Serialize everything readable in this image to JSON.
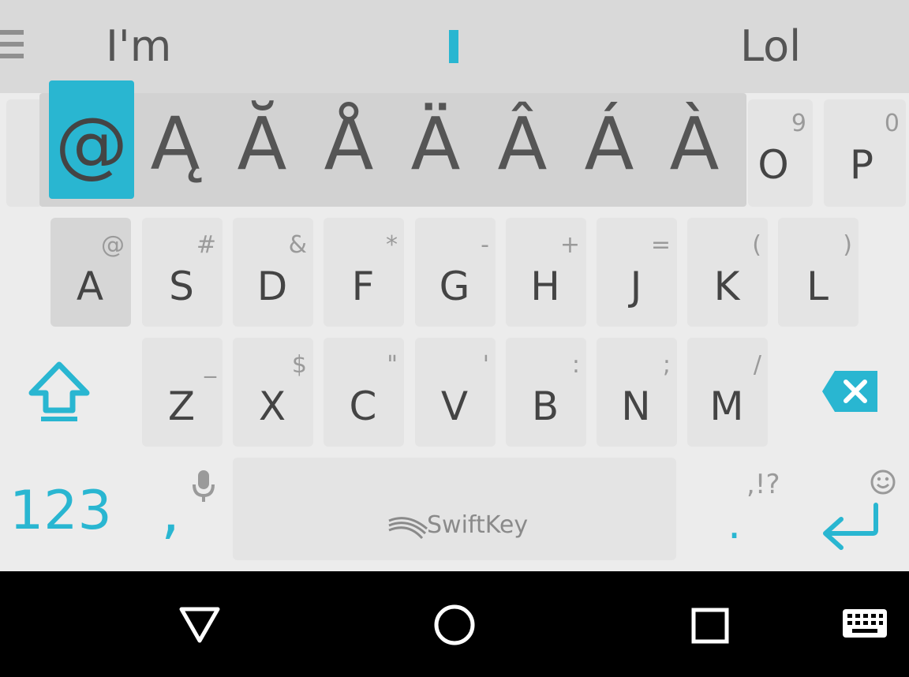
{
  "suggestions": {
    "left": "I'm",
    "middle": "",
    "right": "Lol"
  },
  "popup": {
    "selected": "@",
    "alternates": [
      "Ą",
      "Ă",
      "Å",
      "Ä",
      "Â",
      "Á",
      "À"
    ]
  },
  "row1": [
    {
      "main": "O",
      "hint": "9"
    },
    {
      "main": "P",
      "hint": "0"
    }
  ],
  "row2": [
    {
      "main": "A",
      "hint": "@"
    },
    {
      "main": "S",
      "hint": "#"
    },
    {
      "main": "D",
      "hint": "&"
    },
    {
      "main": "F",
      "hint": "*"
    },
    {
      "main": "G",
      "hint": "-"
    },
    {
      "main": "H",
      "hint": "+"
    },
    {
      "main": "J",
      "hint": "="
    },
    {
      "main": "K",
      "hint": "("
    },
    {
      "main": "L",
      "hint": ")"
    }
  ],
  "row3": [
    {
      "main": "Z",
      "hint": "_"
    },
    {
      "main": "X",
      "hint": "$"
    },
    {
      "main": "C",
      "hint": "\""
    },
    {
      "main": "V",
      "hint": "'"
    },
    {
      "main": "B",
      "hint": ":"
    },
    {
      "main": "N",
      "hint": ";"
    },
    {
      "main": "M",
      "hint": "/"
    }
  ],
  "bottom": {
    "numbers_label": "123",
    "comma_label": ",",
    "space_brand": "SwiftKey",
    "period_label": ".",
    "punct_hint": ",!?"
  },
  "colors": {
    "accent": "#29b6d1",
    "key_bg": "#e4e4e4",
    "keyboard_bg": "#ececec",
    "suggestion_bg": "#d9d9d9",
    "navbar_bg": "#000000"
  },
  "icons": {
    "menu": "menu-icon",
    "shift": "shift-arrow-icon",
    "backspace": "backspace-icon",
    "mic": "microphone-icon",
    "emoji": "emoji-icon",
    "enter": "enter-icon",
    "swiftkey_logo": "swiftkey-logo-icon",
    "nav_back": "back-triangle-icon",
    "nav_home": "home-circle-icon",
    "nav_recent": "recents-square-icon",
    "nav_keyboard": "keyboard-icon"
  }
}
